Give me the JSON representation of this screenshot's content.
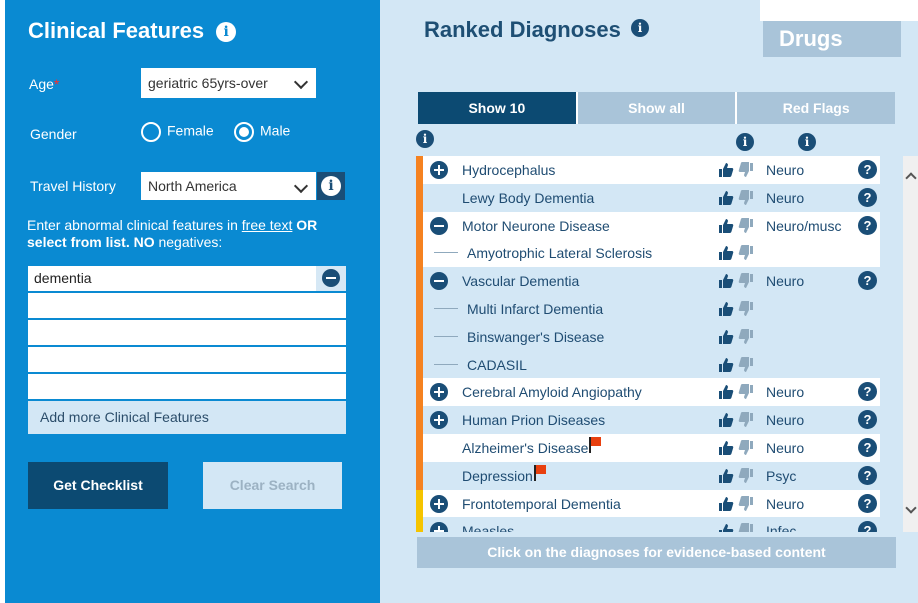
{
  "left": {
    "title": "Clinical Features",
    "age_label": "Age",
    "age_required": "*",
    "age_value": "geriatric 65yrs-over",
    "gender_label": "Gender",
    "gender_options": [
      "Female",
      "Male"
    ],
    "gender_selected": "Male",
    "travel_label": "Travel History",
    "travel_value": "North America",
    "instruction_a": "Enter abnormal clinical features in ",
    "instruction_link": "free text",
    "instruction_b": " OR select from list. ",
    "instruction_no": "NO",
    "instruction_c": " negatives:",
    "features": [
      "dementia",
      "",
      "",
      "",
      ""
    ],
    "add_more_label": "Add more Clinical Features",
    "get_checklist_label": "Get Checklist",
    "clear_search_label": "Clear Search"
  },
  "right": {
    "title": "Ranked Diagnoses",
    "drugs_tab_label": "Drugs",
    "tabs": [
      "Show 10",
      "Show all",
      "Red Flags"
    ],
    "active_tab": "Show 10",
    "footer_label": "Click on the diagnoses for evidence-based content",
    "diagnoses": [
      {
        "name": "Hydrocephalus",
        "icon": "plus-icon",
        "bar": "#f58220",
        "bg": "white",
        "category": "Neuro",
        "help": "?"
      },
      {
        "name": "Lewy Body Dementia",
        "icon": "none",
        "bar": "#f58220",
        "bg": "blue",
        "category": "Neuro",
        "help": "?"
      },
      {
        "name": "Motor Neurone Disease",
        "icon": "minus-icon",
        "bar": "#f58220",
        "bg": "white",
        "category": "Neuro/musc",
        "help": "?"
      },
      {
        "name": "Amyotrophic Lateral Sclerosis",
        "icon": "dash",
        "bar": "#f58220",
        "bg": "white",
        "category": "",
        "help": ""
      },
      {
        "name": "Vascular Dementia",
        "icon": "minus-icon",
        "bar": "#f58220",
        "bg": "blue",
        "category": "Neuro",
        "help": "?"
      },
      {
        "name": "Multi Infarct Dementia",
        "icon": "dash",
        "bar": "#f58220",
        "bg": "blue",
        "category": "",
        "help": ""
      },
      {
        "name": "Binswanger's Disease",
        "icon": "dash",
        "bar": "#f58220",
        "bg": "blue",
        "category": "",
        "help": ""
      },
      {
        "name": "CADASIL",
        "icon": "dash",
        "bar": "#f58220",
        "bg": "blue",
        "category": "",
        "help": ""
      },
      {
        "name": "Cerebral Amyloid Angiopathy",
        "icon": "plus-icon",
        "bar": "#f58220",
        "bg": "white",
        "category": "Neuro",
        "help": "?"
      },
      {
        "name": "Human Prion Diseases",
        "icon": "plus-icon",
        "bar": "#f58220",
        "bg": "blue",
        "category": "Neuro",
        "help": "?"
      },
      {
        "name": "Alzheimer's Disease",
        "icon": "none",
        "bar": "#f58220",
        "bg": "white",
        "category": "Neuro",
        "help": "?",
        "flag": true
      },
      {
        "name": "Depression",
        "icon": "none",
        "bar": "#f58220",
        "bg": "blue",
        "category": "Psyc",
        "help": "?",
        "flag": true
      },
      {
        "name": "Frontotemporal Dementia",
        "icon": "plus-icon",
        "bar": "#f5c400",
        "bg": "white",
        "category": "Neuro",
        "help": "?"
      },
      {
        "name": "Measles",
        "icon": "plus-icon",
        "bar": "#f5c400",
        "bg": "blue",
        "category": "Infec",
        "help": "?"
      }
    ]
  },
  "colors": {
    "left_panel": "#0a8ad2",
    "right_panel": "#d3e7f5",
    "dark_blue": "#0c4a72",
    "muted_blue": "#a9c4d9",
    "orange_bar": "#f58220",
    "yellow_bar": "#f5c400",
    "flag_red": "#e8400f"
  }
}
